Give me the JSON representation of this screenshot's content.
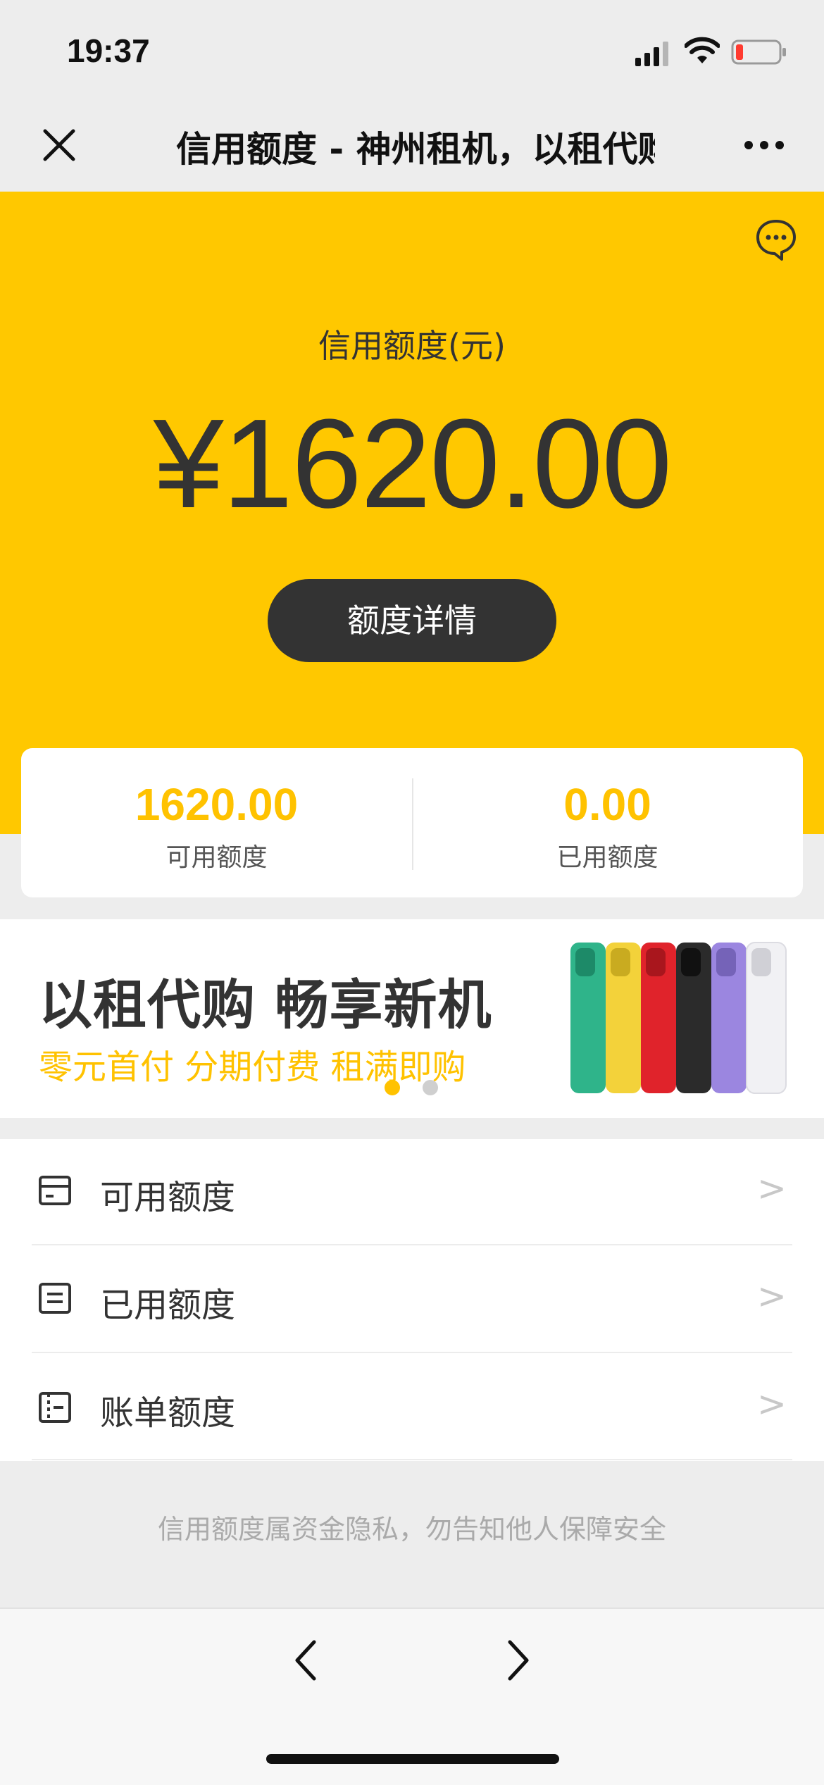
{
  "status_bar": {
    "time": "19:37"
  },
  "nav": {
    "title": "信用额度 - 神州租机，以租代购 畅享新机"
  },
  "hero": {
    "label": "信用额度(元)",
    "amount": "¥1620.00",
    "detail_button": "额度详情"
  },
  "stats": [
    {
      "value": "1620.00",
      "label": "可用额度"
    },
    {
      "value": "0.00",
      "label": "已用额度"
    }
  ],
  "banner": {
    "title": "以租代购 畅享新机",
    "subtitle": "零元首付 分期付费 租满即购",
    "dots": {
      "count": 2,
      "active": 0
    }
  },
  "menu": [
    {
      "label": "可用额度",
      "icon": "card-icon",
      "arrow": ">"
    },
    {
      "label": "已用额度",
      "icon": "document-icon",
      "arrow": ">"
    },
    {
      "label": "账单额度",
      "icon": "bill-icon",
      "arrow": ">"
    }
  ],
  "footer": {
    "note": "信用额度属资金隐私，勿告知他人保障安全"
  },
  "colors": {
    "accent": "#ffc800",
    "accent_text": "#ffc200",
    "dark": "#333333",
    "background": "#ededed"
  }
}
